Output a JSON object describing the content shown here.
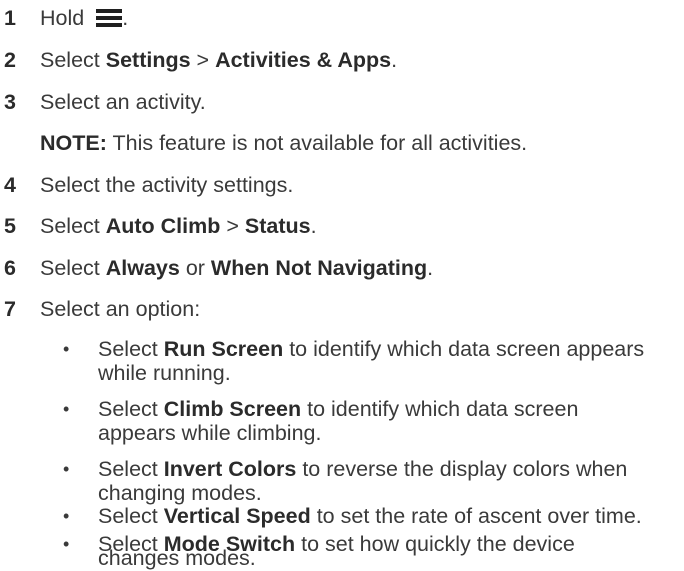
{
  "steps": [
    {
      "n": "1",
      "pre": "Hold ",
      "icon": "menu-icon",
      "post": "."
    },
    {
      "n": "2",
      "pre": "Select ",
      "b1": "Settings",
      "mid": " > ",
      "b2": "Activities & Apps",
      "post": "."
    },
    {
      "n": "3",
      "text": "Select an activity."
    },
    {
      "note_label": "NOTE:",
      "note_text": " This feature is not available for all activities."
    },
    {
      "n": "4",
      "text": "Select the activity settings."
    },
    {
      "n": "5",
      "pre": "Select ",
      "b1": "Auto Climb",
      "mid": " > ",
      "b2": "Status",
      "post": "."
    },
    {
      "n": "6",
      "pre": "Select ",
      "b1": "Always",
      "mid": " or ",
      "b2": "When Not Navigating",
      "post": "."
    },
    {
      "n": "7",
      "text": "Select an option:"
    }
  ],
  "bullets": [
    {
      "pre": "Select ",
      "b": "Run Screen",
      "line1": " to identify which data screen appears",
      "line2": "while running."
    },
    {
      "pre": "Select ",
      "b": "Climb Screen",
      "line1": " to identify which data screen",
      "line2": "appears while climbing."
    },
    {
      "pre": "Select ",
      "b": "Invert Colors",
      "line1": " to reverse the display colors when",
      "line2": "changing modes."
    },
    {
      "pre": "Select ",
      "b": "Vertical Speed",
      "line1": " to set the rate of ascent over time.",
      "line2": ""
    },
    {
      "pre": "Select ",
      "b": "Mode Switch",
      "line1": " to set how quickly the device",
      "line2": "changes modes."
    }
  ],
  "bullet_char": "•",
  "colors": {
    "text": "#3a3a3a",
    "bold": "#2b2b2b",
    "icon": "#1f1f1f"
  }
}
